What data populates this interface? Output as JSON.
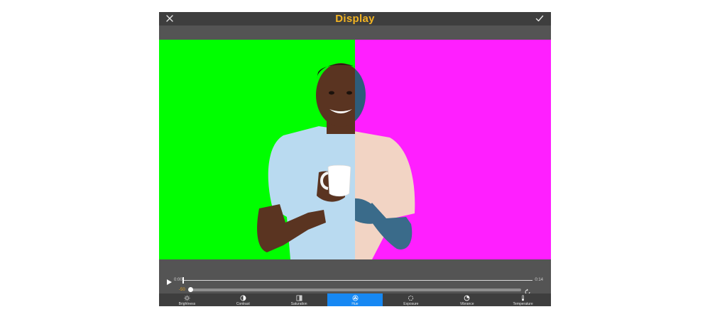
{
  "app": {
    "title": "Display",
    "close_icon": "close-icon",
    "confirm_icon": "checkmark-icon"
  },
  "stage": {
    "left_background": "#00ff00",
    "right_background": "#ff1fff",
    "title_color": "#f3b422"
  },
  "transport": {
    "play_icon": "play-icon",
    "current_time": "0:00",
    "total_time": "0:14",
    "progress": 0.0
  },
  "adjust": {
    "value": "-50",
    "level": 0.0,
    "reset_icon": "reset-icon"
  },
  "tools": [
    {
      "label": "Brightness",
      "icon": "brightness-icon",
      "active": false
    },
    {
      "label": "Contrast",
      "icon": "contrast-icon",
      "active": false
    },
    {
      "label": "Saturation",
      "icon": "saturation-icon",
      "active": false
    },
    {
      "label": "Hue",
      "icon": "hue-icon",
      "active": true
    },
    {
      "label": "Exposure",
      "icon": "exposure-icon",
      "active": false
    },
    {
      "label": "Vibrance",
      "icon": "vibrance-icon",
      "active": false
    },
    {
      "label": "Temperature",
      "icon": "temperature-icon",
      "active": false
    }
  ],
  "colors": {
    "active_tool": "#1688f3",
    "accent_value": "#e0a020"
  }
}
